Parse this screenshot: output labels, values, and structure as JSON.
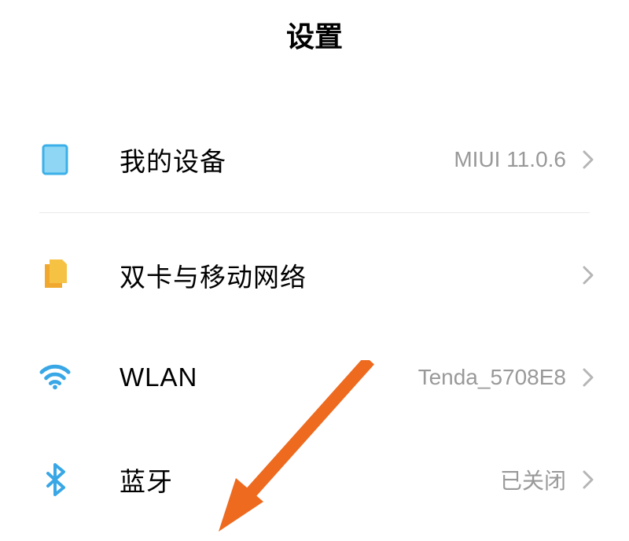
{
  "header": {
    "title": "设置"
  },
  "items": {
    "mydevice": {
      "label": "我的设备",
      "value": "MIUI 11.0.6"
    },
    "sim": {
      "label": "双卡与移动网络",
      "value": ""
    },
    "wlan": {
      "label": "WLAN",
      "value": "Tenda_5708E8"
    },
    "bluetooth": {
      "label": "蓝牙",
      "value": "已关闭"
    }
  },
  "colors": {
    "accent_blue": "#39a7e6",
    "accent_amber": "#f6bb42",
    "arrow": "#ed6a1f"
  }
}
